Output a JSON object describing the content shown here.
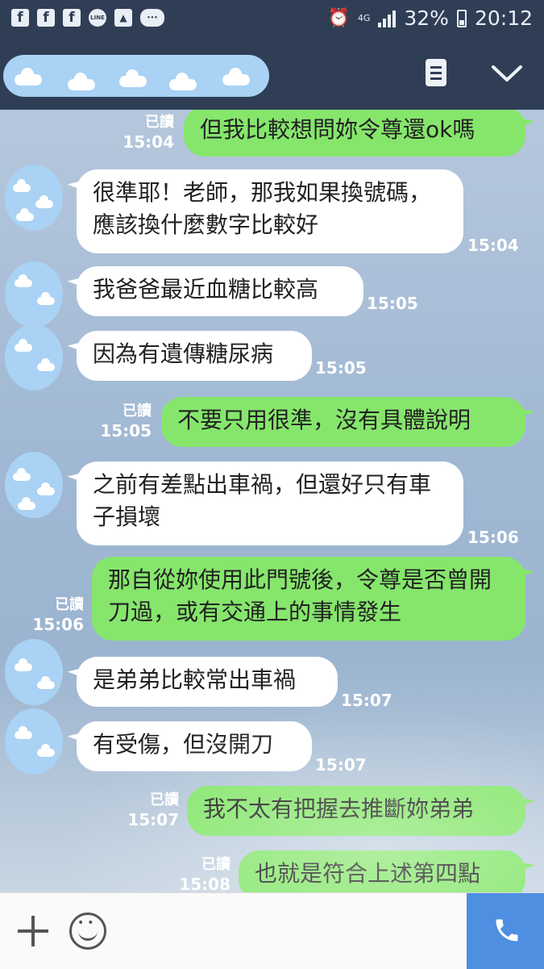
{
  "status_bar": {
    "battery": "32%",
    "time": "20:12",
    "network": "4G",
    "icons": [
      "facebook-icon",
      "facebook-icon",
      "facebook-icon",
      "line-icon",
      "image-icon",
      "app-icon"
    ]
  },
  "messages": [
    {
      "side": "out",
      "text": "但我比較想問妳令尊還ok嗎",
      "read": "已讀",
      "time": "15:04"
    },
    {
      "side": "in",
      "text": "很準耶！老師，那我如果換號碼，應該換什麼數字比較好",
      "time": "15:04"
    },
    {
      "side": "in",
      "text": "我爸爸最近血糖比較高",
      "time": "15:05"
    },
    {
      "side": "in",
      "text": "因為有遺傳糖尿病",
      "time": "15:05"
    },
    {
      "side": "out",
      "text": "不要只用很準，沒有具體說明",
      "read": "已讀",
      "time": "15:05"
    },
    {
      "side": "in",
      "text": "之前有差點出車禍，但還好只有車子損壞",
      "time": "15:06"
    },
    {
      "side": "out",
      "text": "那自從妳使用此門號後，令尊是否曾開刀過，或有交通上的事情發生",
      "read": "已讀",
      "time": "15:06"
    },
    {
      "side": "in",
      "text": "是弟弟比較常出車禍",
      "time": "15:07"
    },
    {
      "side": "in",
      "text": "有受傷，但沒開刀",
      "time": "15:07"
    },
    {
      "side": "out",
      "text": "我不太有把握去推斷妳弟弟",
      "read": "已讀",
      "time": "15:07"
    },
    {
      "side": "out",
      "text": "也就是符合上述第四點",
      "read": "已讀",
      "time": "15:08"
    }
  ],
  "colors": {
    "header": "#2f3e55",
    "outgoing": "#86e66c",
    "incoming": "#ffffff",
    "call": "#4e8fe2"
  }
}
